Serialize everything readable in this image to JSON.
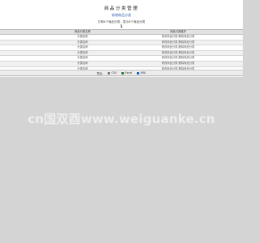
{
  "page": {
    "title": "商品分类管理",
    "add_link": "新增商品分类",
    "summary": "共有8个商品分类，显示8个商品分类",
    "page_number": "1"
  },
  "table": {
    "headers": [
      "",
      "商品分类名称",
      "商品分类维护"
    ],
    "rows": [
      {
        "index": "",
        "name": "分类名称",
        "actions": "修改商品分类 删除商品分类"
      },
      {
        "index": "",
        "name": "分类名称",
        "actions": "修改商品分类 删除商品分类"
      },
      {
        "index": "",
        "name": "分类名称",
        "actions": "修改商品分类 删除商品分类"
      },
      {
        "index": "",
        "name": "分类名称",
        "actions": "修改商品分类 删除商品分类"
      },
      {
        "index": "",
        "name": "分类名称",
        "actions": "修改商品分类 删除商品分类"
      },
      {
        "index": "",
        "name": "分类名称",
        "actions": "修改商品分类 删除商品分类"
      },
      {
        "index": "",
        "name": "分类名称",
        "actions": "修改商品分类 删除商品分类"
      },
      {
        "index": "",
        "name": "分类名称",
        "actions": "修改商品分类 删除商品分类"
      }
    ]
  },
  "export": {
    "label": "导出:",
    "options": [
      {
        "label": "CSV",
        "icon": "csv-icon"
      },
      {
        "label": "Excel",
        "icon": "excel-icon"
      },
      {
        "label": "XML",
        "icon": "xml-icon"
      }
    ]
  },
  "watermark": "cn国双酉www.weiguanke.cn",
  "colors": {
    "background": "#d4d4d4",
    "link": "#2a5db0",
    "header_bg": "#e2e2e2"
  }
}
